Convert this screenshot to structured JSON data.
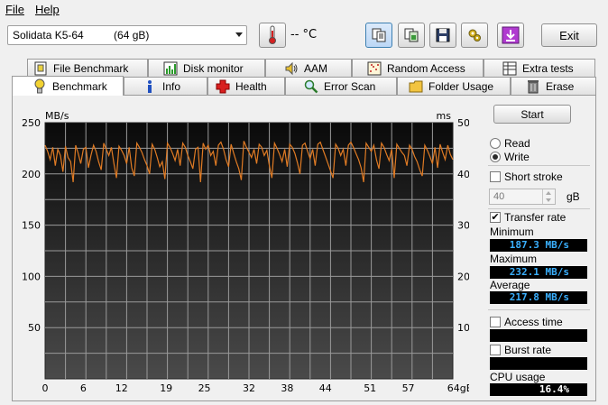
{
  "menu": {
    "file": "File",
    "help": "Help"
  },
  "toolbar": {
    "drive": "Solidata K5-64          (64 gB)",
    "temperature": "-- °C",
    "exit": "Exit"
  },
  "tabs_top": [
    {
      "label": "File Benchmark",
      "icon": "file-benchmark-icon"
    },
    {
      "label": "Disk monitor",
      "icon": "disk-monitor-icon"
    },
    {
      "label": "AAM",
      "icon": "speaker-icon"
    },
    {
      "label": "Random Access",
      "icon": "random-access-icon"
    },
    {
      "label": "Extra tests",
      "icon": "extra-tests-icon"
    }
  ],
  "tabs_bottom": [
    {
      "label": "Benchmark",
      "icon": "lightbulb-icon"
    },
    {
      "label": "Info",
      "icon": "info-icon"
    },
    {
      "label": "Health",
      "icon": "health-cross-icon"
    },
    {
      "label": "Error Scan",
      "icon": "magnifier-icon"
    },
    {
      "label": "Folder Usage",
      "icon": "folder-icon"
    },
    {
      "label": "Erase",
      "icon": "trash-icon"
    }
  ],
  "controls": {
    "start": "Start",
    "read": "Read",
    "write": "Write",
    "mode_selected": "Write",
    "short_stroke": "Short stroke",
    "short_stroke_checked": false,
    "stroke_value": "40",
    "stroke_unit": "gB",
    "transfer_rate": "Transfer rate",
    "transfer_rate_checked": true,
    "access_time": "Access time",
    "access_time_checked": false,
    "burst_rate": "Burst rate",
    "burst_rate_checked": false
  },
  "stats": {
    "minimum_label": "Minimum",
    "minimum_value": "187.3 MB/s",
    "maximum_label": "Maximum",
    "maximum_value": "232.1 MB/s",
    "average_label": "Average",
    "average_value": "217.8 MB/s",
    "cpu_label": "CPU usage",
    "cpu_value": "16.4%"
  },
  "chart_data": {
    "type": "line",
    "y_left_label": "MB/s",
    "y_right_label": "ms",
    "x_unit": "gB",
    "x_ticks": [
      0,
      6,
      12,
      19,
      25,
      32,
      38,
      44,
      51,
      57,
      64
    ],
    "y_left_ticks": [
      50,
      100,
      150,
      200,
      250
    ],
    "y_right_ticks": [
      10,
      20,
      30,
      40,
      50
    ],
    "x_range": [
      0,
      64
    ],
    "y_left_range": [
      0,
      250
    ],
    "y_right_range": [
      0,
      50
    ],
    "grid": true,
    "series": [
      {
        "color": "#e07b24",
        "x": [
          0,
          0.4,
          0.8,
          1.2,
          1.6,
          2.0,
          2.4,
          2.8,
          3.2,
          3.6,
          4.0,
          4.4,
          4.8,
          5.2,
          5.6,
          6.0,
          6.4,
          6.8,
          7.2,
          7.6,
          8.0,
          8.4,
          8.8,
          9.2,
          9.6,
          10.0,
          10.4,
          10.8,
          11.2,
          11.6,
          12.0,
          12.4,
          12.8,
          13.2,
          13.6,
          14.0,
          14.4,
          14.8,
          15.2,
          15.6,
          16.0,
          16.4,
          16.8,
          17.2,
          17.6,
          18.0,
          18.4,
          18.8,
          19.2,
          19.6,
          20.0,
          20.4,
          20.8,
          21.2,
          21.6,
          22.0,
          22.4,
          22.8,
          23.2,
          23.6,
          24.0,
          24.4,
          24.8,
          25.2,
          25.6,
          26.0,
          26.4,
          26.8,
          27.2,
          27.6,
          28.0,
          28.4,
          28.8,
          29.2,
          29.6,
          30.0,
          30.4,
          30.8,
          31.2,
          31.6,
          32.0,
          32.4,
          32.8,
          33.2,
          33.6,
          34.0,
          34.4,
          34.8,
          35.2,
          35.6,
          36.0,
          36.4,
          36.8,
          37.2,
          37.6,
          38.0,
          38.4,
          38.8,
          39.2,
          39.6,
          40.0,
          40.4,
          40.8,
          41.2,
          41.6,
          42.0,
          42.4,
          42.8,
          43.2,
          43.6,
          44.0,
          44.4,
          44.8,
          45.2,
          45.6,
          46.0,
          46.4,
          46.8,
          47.2,
          47.6,
          48.0,
          48.4,
          48.8,
          49.2,
          49.6,
          50.0,
          50.4,
          50.8,
          51.2,
          51.6,
          52.0,
          52.4,
          52.8,
          53.2,
          53.6,
          54.0,
          54.4,
          54.8,
          55.2,
          55.6,
          56.0,
          56.4,
          56.8,
          57.2,
          57.6,
          58.0,
          58.4,
          58.8,
          59.2,
          59.6,
          60.0,
          60.4,
          60.8,
          61.2,
          61.6,
          62.0,
          62.4,
          62.8,
          63.2,
          63.6,
          64.0
        ],
        "y": [
          228,
          222,
          214,
          226,
          208,
          224,
          218,
          202,
          227,
          216,
          212,
          192,
          228,
          220,
          210,
          224,
          226,
          206,
          218,
          228,
          222,
          212,
          204,
          230,
          224,
          218,
          226,
          210,
          196,
          227,
          223,
          218,
          210,
          226,
          206,
          198,
          230,
          226,
          221,
          214,
          208,
          200,
          229,
          224,
          216,
          207,
          212,
          195,
          230,
          226,
          220,
          213,
          224,
          208,
          230,
          226,
          218,
          212,
          205,
          224,
          226,
          192,
          230,
          224,
          228,
          218,
          222,
          208,
          228,
          231,
          224,
          214,
          207,
          229,
          220,
          212,
          205,
          194,
          232,
          226,
          221,
          216,
          224,
          210,
          229,
          226,
          218,
          223,
          208,
          196,
          230,
          225,
          219,
          212,
          224,
          207,
          229,
          226,
          220,
          211,
          200,
          228,
          230,
          222,
          215,
          224,
          208,
          229,
          231,
          224,
          217,
          210,
          203,
          196,
          229,
          225,
          218,
          224,
          208,
          228,
          231,
          226,
          220,
          214,
          206,
          192,
          230,
          226,
          222,
          228,
          214,
          205,
          230,
          226,
          219,
          213,
          224,
          196,
          229,
          225,
          221,
          218,
          208,
          228,
          224,
          217,
          212,
          204,
          198,
          228,
          223,
          217,
          210,
          226,
          206,
          229,
          221,
          214,
          228,
          219,
          214
        ]
      }
    ]
  }
}
